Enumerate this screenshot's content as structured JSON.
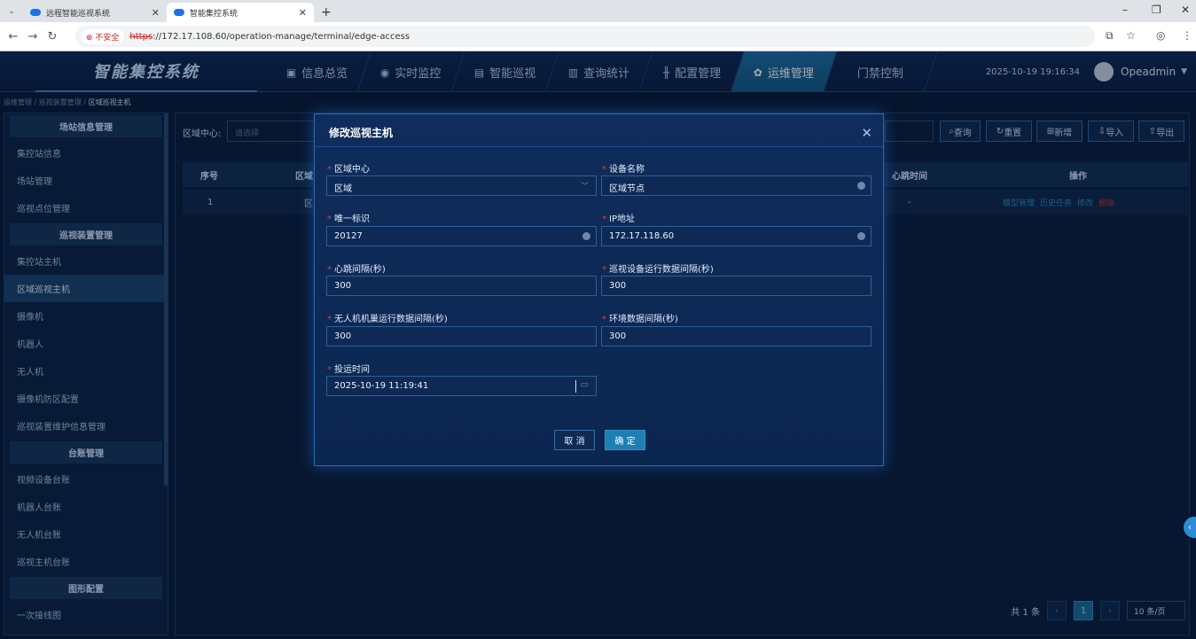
{
  "browser": {
    "tabs": [
      {
        "label": "远程智能巡视系统",
        "active": false
      },
      {
        "label": "智能集控系统",
        "active": true
      }
    ],
    "new_tab": "+",
    "insecure_label": "不安全",
    "url_scheme": "https",
    "url_rest": "://172.17.108.60/operation-manage/terminal/edge-access"
  },
  "header": {
    "brand": "智能集控系统",
    "menu": [
      {
        "label": "信息总览",
        "icon": "chart-icon"
      },
      {
        "label": "实时监控",
        "icon": "monitor-icon"
      },
      {
        "label": "智能巡视",
        "icon": "robot-icon"
      },
      {
        "label": "查询统计",
        "icon": "stats-icon"
      },
      {
        "label": "配置管理",
        "icon": "sliders-icon"
      },
      {
        "label": "运维管理",
        "icon": "gears-icon",
        "active": true
      },
      {
        "label": "门禁控制",
        "icon": ""
      }
    ],
    "datetime": "2025-10-19 19:16:34",
    "user": "Opeadmin"
  },
  "breadcrumb": [
    "运维管理",
    "巡视装置管理",
    "区域巡视主机"
  ],
  "sidebar": {
    "groups": [
      {
        "title": "场站信息管理",
        "items": [
          "集控站信息",
          "场站管理",
          "巡视点位管理"
        ]
      },
      {
        "title": "巡视装置管理",
        "items": [
          "集控站主机",
          "区域巡视主机",
          "摄像机",
          "机器人",
          "无人机",
          "摄像机防区配置",
          "巡视装置维护信息管理"
        ]
      },
      {
        "title": "台账管理",
        "items": [
          "视频设备台账",
          "机器人台账",
          "无人机台账",
          "巡视主机台账"
        ]
      },
      {
        "title": "图形配置",
        "items": [
          "一次接线图"
        ]
      }
    ],
    "active_item": "区域巡视主机"
  },
  "search": {
    "label": "区域中心:",
    "placeholder": "请选择",
    "buttons": [
      "查询",
      "重置",
      "新增",
      "导入",
      "导出"
    ]
  },
  "table": {
    "headers": [
      "序号",
      "区域",
      "心跳时间",
      "操作"
    ],
    "rows": [
      {
        "index": "1",
        "region": "区",
        "heartbeat": "-"
      }
    ],
    "ops": [
      "模型管理",
      "历史任务",
      "修改",
      "删除"
    ]
  },
  "pagination": {
    "total": "共 1 条",
    "page": "1",
    "size": "10 条/页"
  },
  "modal": {
    "title": "修改巡视主机",
    "fields": {
      "region_center": {
        "label": "区域中心",
        "value": "区域"
      },
      "device_name": {
        "label": "设备名称",
        "value": "区域节点"
      },
      "unique_id": {
        "label": "唯一标识",
        "value": "20127"
      },
      "ip": {
        "label": "IP地址",
        "value": "172.17.118.60"
      },
      "heartbeat": {
        "label": "心跳间隔(秒)",
        "value": "300"
      },
      "device_run": {
        "label": "巡视设备运行数据间隔(秒)",
        "value": "300"
      },
      "uav_nest": {
        "label": "无人机机巢运行数据间隔(秒)",
        "value": "300"
      },
      "env": {
        "label": "环境数据间隔(秒)",
        "value": "300"
      },
      "commission_time": {
        "label": "投运时间",
        "value": "2025-10-19 11:19:41"
      }
    },
    "cancel": "取 消",
    "confirm": "确 定"
  }
}
